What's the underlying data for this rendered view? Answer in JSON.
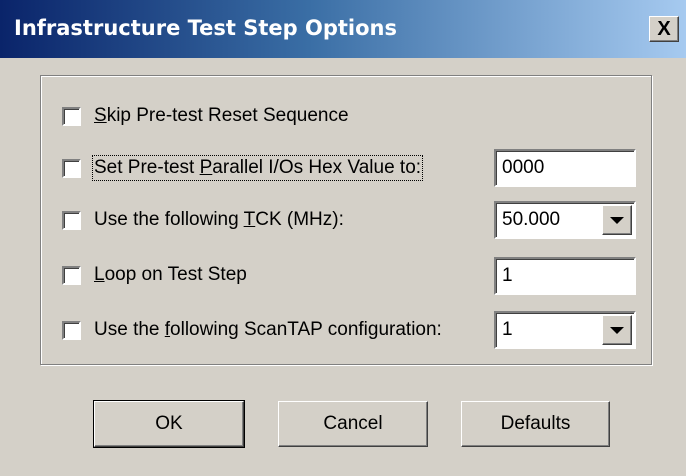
{
  "window": {
    "title": "Infrastructure Test Step Options",
    "close_label": "X"
  },
  "options": [
    {
      "pre": "",
      "accel": "S",
      "post": "kip Pre-test Reset Sequence",
      "checked": false
    },
    {
      "pre": "Set Pre-test ",
      "accel": "P",
      "post": "arallel I/Os Hex Value to:",
      "checked": false,
      "value": "0000"
    },
    {
      "pre": "Use the following ",
      "accel": "T",
      "post": "CK (MHz):",
      "checked": false,
      "value": "50.000"
    },
    {
      "pre": "",
      "accel": "L",
      "post": "oop on Test Step",
      "checked": false,
      "value": "1"
    },
    {
      "pre": "Use the ",
      "accel": "f",
      "post": "ollowing ScanTAP configuration:",
      "checked": false,
      "value": "1"
    }
  ],
  "buttons": {
    "ok": "OK",
    "cancel": "Cancel",
    "defaults": "Defaults"
  }
}
